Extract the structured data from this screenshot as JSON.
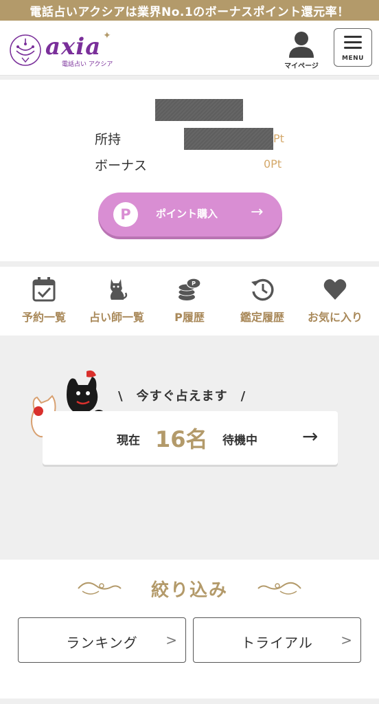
{
  "banner": {
    "text": "電話占いアクシアは業界No.1のボーナスポイント還元率！"
  },
  "header": {
    "logo": {
      "name": "axia",
      "sub": "電話占い アクシア"
    },
    "mypage_label": "マイページ",
    "menu_label": "MENU"
  },
  "points": {
    "owned_label": "所持",
    "owned_unit": "Pt",
    "bonus_label": "ボーナス",
    "bonus_value": "0Pt",
    "buy": {
      "p_glyph": "P",
      "label": "ポイント購入",
      "arrow": "→"
    }
  },
  "quicknav": [
    {
      "label": "予約一覧",
      "icon": "calendar-check-icon"
    },
    {
      "label": "占い師一覧",
      "icon": "cat-icon"
    },
    {
      "label": "P履歴",
      "icon": "coin-stack-icon"
    },
    {
      "label": "鑑定履歴",
      "icon": "history-clock-icon"
    },
    {
      "label": "お気に入り",
      "icon": "heart-icon"
    }
  ],
  "waiting": {
    "headline": "\\　今すぐ占えます　/",
    "prefix": "現在",
    "count": "16名",
    "suffix": "待機中",
    "arrow": "→"
  },
  "filter": {
    "title": "絞り込み",
    "buttons": [
      {
        "label": "ランキング",
        "chevron": ">"
      },
      {
        "label": "トライアル",
        "chevron": ">"
      }
    ]
  },
  "colors": {
    "gold": "#b39a6a",
    "brand_purple": "#7a2f9a",
    "pink": "#d98ed3"
  }
}
